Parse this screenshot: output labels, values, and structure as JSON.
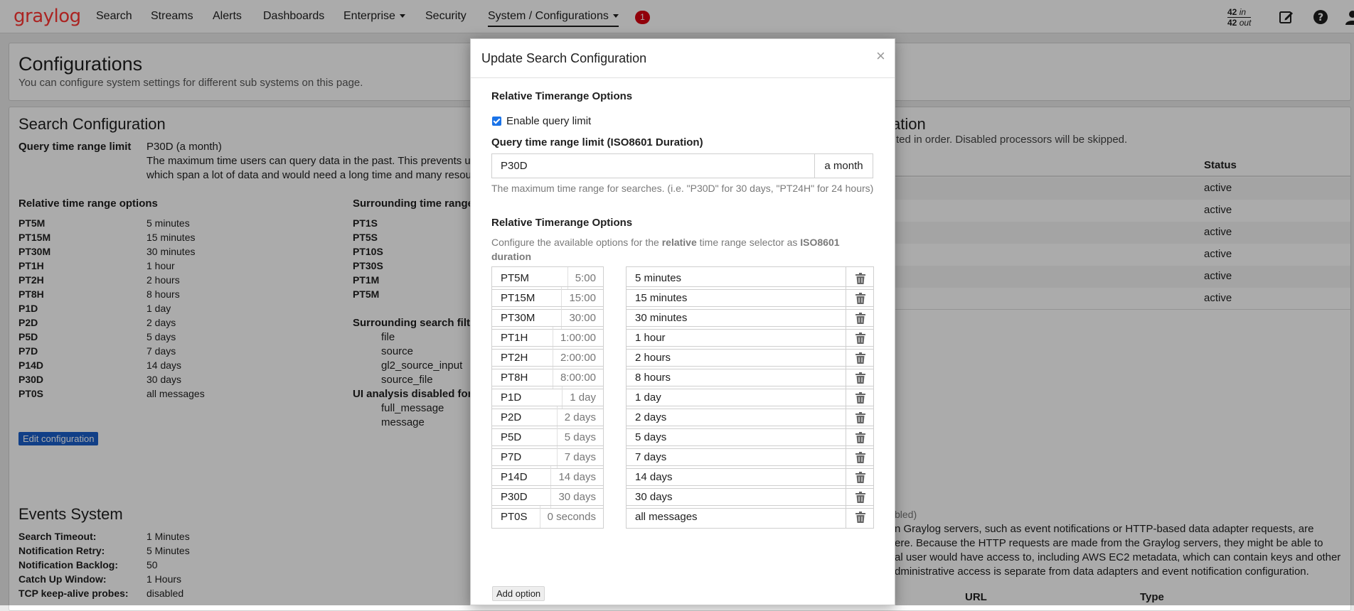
{
  "navbar": {
    "logo": "graylog",
    "items": [
      "Search",
      "Streams",
      "Alerts",
      "Dashboards",
      "Enterprise",
      "Security",
      "System / Configurations"
    ],
    "notification_count": "1",
    "throughput_in": "42",
    "throughput_in_unit": "in",
    "throughput_out": "42",
    "throughput_out_unit": "out",
    "icons": [
      "edit-icon",
      "help-icon",
      "user-icon"
    ]
  },
  "page": {
    "title": "Configurations",
    "description": "You can configure system settings for different sub systems on this page."
  },
  "search_config": {
    "title": "Search Configuration",
    "query_limit_label": "Query time range limit",
    "query_limit_value": "P30D (a month)",
    "query_limit_desc_1": "The maximum time users can query data in the past. This prevents us",
    "query_limit_desc_2": "which span a lot of data and would need a long time and many resou",
    "relative_title": "Relative time range options",
    "relative_options": [
      {
        "key": "PT5M",
        "value": "5 minutes"
      },
      {
        "key": "PT15M",
        "value": "15 minutes"
      },
      {
        "key": "PT30M",
        "value": "30 minutes"
      },
      {
        "key": "PT1H",
        "value": "1 hour"
      },
      {
        "key": "PT2H",
        "value": "2 hours"
      },
      {
        "key": "PT8H",
        "value": "8 hours"
      },
      {
        "key": "P1D",
        "value": "1 day"
      },
      {
        "key": "P2D",
        "value": "2 days"
      },
      {
        "key": "P5D",
        "value": "5 days"
      },
      {
        "key": "P7D",
        "value": "7 days"
      },
      {
        "key": "P14D",
        "value": "14 days"
      },
      {
        "key": "P30D",
        "value": "30 days"
      },
      {
        "key": "PT0S",
        "value": "all messages"
      }
    ],
    "surrounding_title": "Surrounding time range",
    "surrounding_options": [
      "PT1S",
      "PT5S",
      "PT10S",
      "PT30S",
      "PT1M",
      "PT5M"
    ],
    "surrounding_filter_title": "Surrounding search filt",
    "surrounding_filter_fields": [
      "file",
      "source",
      "gl2_source_input",
      "source_file"
    ],
    "ui_disabled_title": "UI analysis disabled for",
    "ui_disabled_fields": [
      "full_message",
      "message"
    ],
    "edit_button": "Edit configuration"
  },
  "message_processors": {
    "title_fragment": "ation",
    "desc_fragment": "ted in order. Disabled processors will be skipped.",
    "status_header": "Status",
    "statuses": [
      "active",
      "active",
      "active",
      "active",
      "active",
      "active"
    ]
  },
  "events_system": {
    "title": "Events System",
    "rows": [
      {
        "key": "Search Timeout:",
        "value": "1 Minutes"
      },
      {
        "key": "Notification Retry:",
        "value": "5 Minutes"
      },
      {
        "key": "Notification Backlog:",
        "value": "50"
      },
      {
        "key": "Catch Up Window:",
        "value": "1 Hours"
      },
      {
        "key": "TCP keep-alive probes:",
        "value": "disabled"
      }
    ]
  },
  "url_whitelist": {
    "status_fragment": "bled)",
    "desc_lines": [
      "n Graylog servers, such as event notifications or HTTP-based data adapter requests, are",
      "ere. Because the HTTP requests are made from the Graylog servers, they might be able to",
      "al user would have access to, including AWS EC2 metadata, which can contain keys and other",
      "dministrative access is separate from data adapters and event notification configuration."
    ],
    "col_url": "URL",
    "col_type": "Type"
  },
  "modal": {
    "title": "Update Search Configuration",
    "close": "×",
    "section1_title": "Relative Timerange Options",
    "enable_limit_label": "Enable query limit",
    "enable_limit_checked": true,
    "limit_field_label": "Query time range limit (ISO8601 Duration)",
    "limit_field_value": "P30D",
    "limit_field_addon": "a month",
    "limit_help": "The maximum time range for searches. (i.e. \"P30D\" for 30 days, \"PT24H\" for 24 hours)",
    "section2_title": "Relative Timerange Options",
    "section2_help_pre": "Configure the available options for the ",
    "section2_help_b1": "relative",
    "section2_help_mid": " time range selector as ",
    "section2_help_b2": "ISO8601 duration",
    "options": [
      {
        "code": "PT5M",
        "duration": "5:00",
        "label": "5 minutes"
      },
      {
        "code": "PT15M",
        "duration": "15:00",
        "label": "15 minutes"
      },
      {
        "code": "PT30M",
        "duration": "30:00",
        "label": "30 minutes"
      },
      {
        "code": "PT1H",
        "duration": "1:00:00",
        "label": "1 hour"
      },
      {
        "code": "PT2H",
        "duration": "2:00:00",
        "label": "2 hours"
      },
      {
        "code": "PT8H",
        "duration": "8:00:00",
        "label": "8 hours"
      },
      {
        "code": "P1D",
        "duration": "1 day",
        "label": "1 day"
      },
      {
        "code": "P2D",
        "duration": "2 days",
        "label": "2 days"
      },
      {
        "code": "P5D",
        "duration": "5 days",
        "label": "5 days"
      },
      {
        "code": "P7D",
        "duration": "7 days",
        "label": "7 days"
      },
      {
        "code": "P14D",
        "duration": "14 days",
        "label": "14 days"
      },
      {
        "code": "P30D",
        "duration": "30 days",
        "label": "30 days"
      },
      {
        "code": "PT0S",
        "duration": "0 seconds",
        "label": "all messages"
      }
    ],
    "add_option": "Add option"
  }
}
